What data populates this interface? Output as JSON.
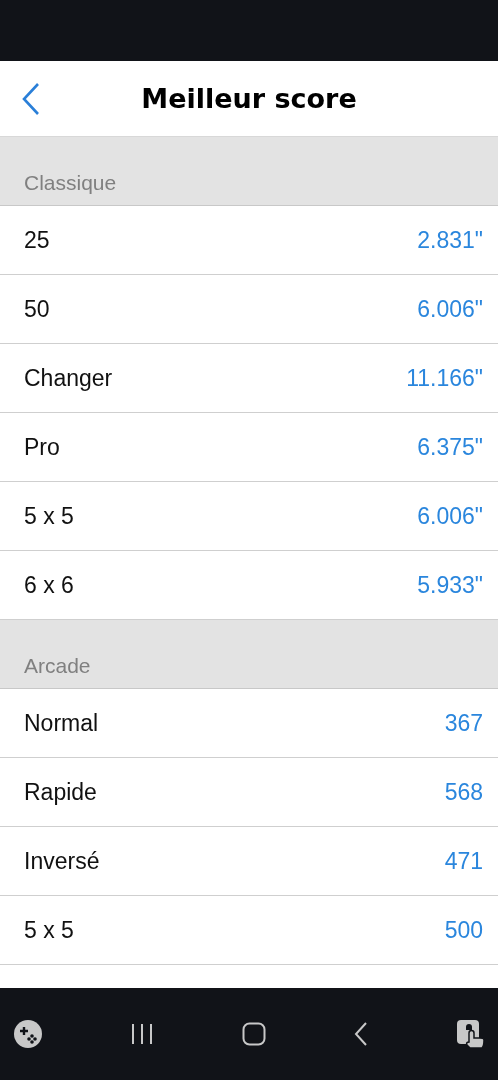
{
  "header": {
    "title": "Meilleur score"
  },
  "sections": [
    {
      "title": "Classique",
      "rows": [
        {
          "label": "25",
          "value": "2.831\""
        },
        {
          "label": "50",
          "value": "6.006\""
        },
        {
          "label": "Changer",
          "value": "11.166\""
        },
        {
          "label": "Pro",
          "value": "6.375\""
        },
        {
          "label": "5 x 5",
          "value": "6.006\""
        },
        {
          "label": "6 x 6",
          "value": "5.933\""
        }
      ]
    },
    {
      "title": "Arcade",
      "rows": [
        {
          "label": "Normal",
          "value": "367"
        },
        {
          "label": "Rapide",
          "value": "568"
        },
        {
          "label": "Inversé",
          "value": "471"
        },
        {
          "label": "5 x 5",
          "value": "500"
        }
      ]
    }
  ]
}
